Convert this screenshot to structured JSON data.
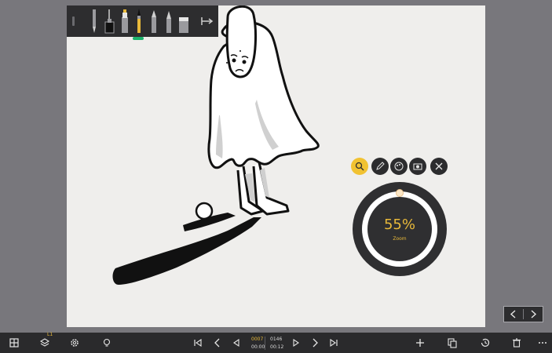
{
  "top_toolbar": {
    "tools": [
      {
        "id": "pen",
        "icon": "pen-icon"
      },
      {
        "id": "ink-bottle",
        "icon": "ink-bottle-icon"
      },
      {
        "id": "marker",
        "icon": "marker-icon"
      },
      {
        "id": "brush",
        "icon": "brush-icon",
        "active": true
      },
      {
        "id": "pencil",
        "icon": "pencil-icon"
      },
      {
        "id": "fineliner",
        "icon": "fineliner-icon"
      },
      {
        "id": "eraser",
        "icon": "eraser-icon"
      }
    ],
    "expand_icon": "expand-arrow-icon"
  },
  "radial_menu": {
    "tools": [
      {
        "id": "zoom",
        "icon": "zoom-icon",
        "active": true
      },
      {
        "id": "pen",
        "icon": "pen-edit-icon"
      },
      {
        "id": "palette",
        "icon": "palette-icon"
      },
      {
        "id": "camera",
        "icon": "camera-icon"
      },
      {
        "id": "close",
        "icon": "close-icon"
      }
    ],
    "dial": {
      "value": "55%",
      "label": "Zoom"
    }
  },
  "page_nav": {
    "prev_icon": "chevron-left-icon",
    "next_icon": "chevron-right-icon"
  },
  "bottom_bar": {
    "layer_badge": "L1",
    "frame": {
      "current": "0007",
      "current_time": "00:00",
      "total": "0146",
      "total_time": "00:12"
    }
  },
  "colors": {
    "accent": "#f1c232",
    "zoom_text": "#e8b93a",
    "toolbar_bg": "#2d2d2f",
    "canvas_bg": "#efeeec",
    "active_tool_tag": "#1bb36b"
  }
}
